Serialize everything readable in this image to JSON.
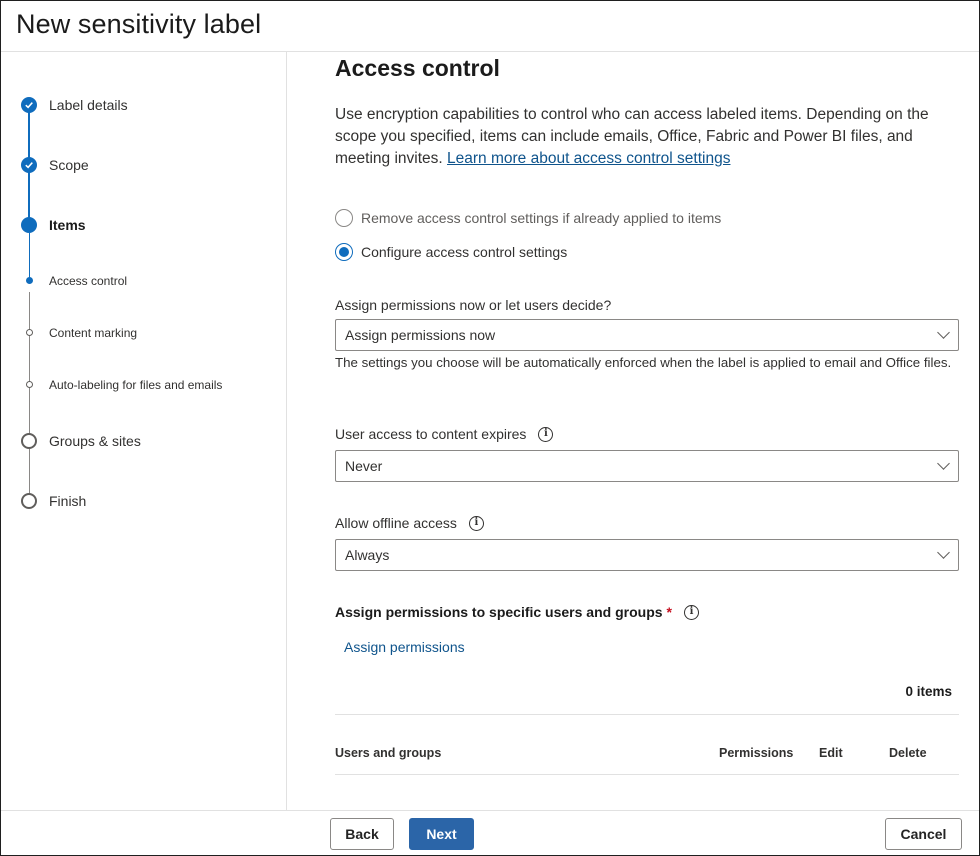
{
  "header": {
    "title": "New sensitivity label"
  },
  "steps": [
    {
      "label": "Label details",
      "state": "done"
    },
    {
      "label": "Scope",
      "state": "done"
    },
    {
      "label": "Items",
      "state": "current"
    },
    {
      "label": "Access control",
      "state": "sub-current"
    },
    {
      "label": "Content marking",
      "state": "sub-todo"
    },
    {
      "label": "Auto-labeling for files and emails",
      "state": "sub-todo"
    },
    {
      "label": "Groups & sites",
      "state": "todo"
    },
    {
      "label": "Finish",
      "state": "todo"
    }
  ],
  "main": {
    "title": "Access control",
    "intro": "Use encryption capabilities to control who can access labeled items. Depending on the scope you specified, items can include emails, Office, Fabric and Power BI files, and meeting invites.",
    "intro_link": "Learn more about access control settings",
    "radio_options": [
      {
        "label": "Remove access control settings if already applied to items",
        "checked": false
      },
      {
        "label": "Configure access control settings",
        "checked": true
      }
    ],
    "assign_question": "Assign permissions now or let users decide?",
    "assign_value": "Assign permissions now",
    "assign_helper": "The settings you choose will be automatically enforced when the label is applied to email and Office files.",
    "expires_label": "User access to content expires",
    "expires_value": "Never",
    "offline_label": "Allow offline access",
    "offline_value": "Always",
    "specific_label": "Assign permissions to specific users and groups",
    "required_mark": "*",
    "assign_link": "Assign permissions",
    "count": "0 items",
    "columns": [
      "Users and groups",
      "Permissions",
      "Edit",
      "Delete"
    ]
  },
  "footer": {
    "back": "Back",
    "next": "Next",
    "cancel": "Cancel"
  },
  "colors": {
    "accent": "#0f6cbd",
    "primary_button": "#2b65a8",
    "link": "#0f548c",
    "required": "#c50f1f"
  },
  "icons": {
    "done": "checkmark-icon",
    "info": "info-icon",
    "dropdown": "chevron-down-icon"
  }
}
